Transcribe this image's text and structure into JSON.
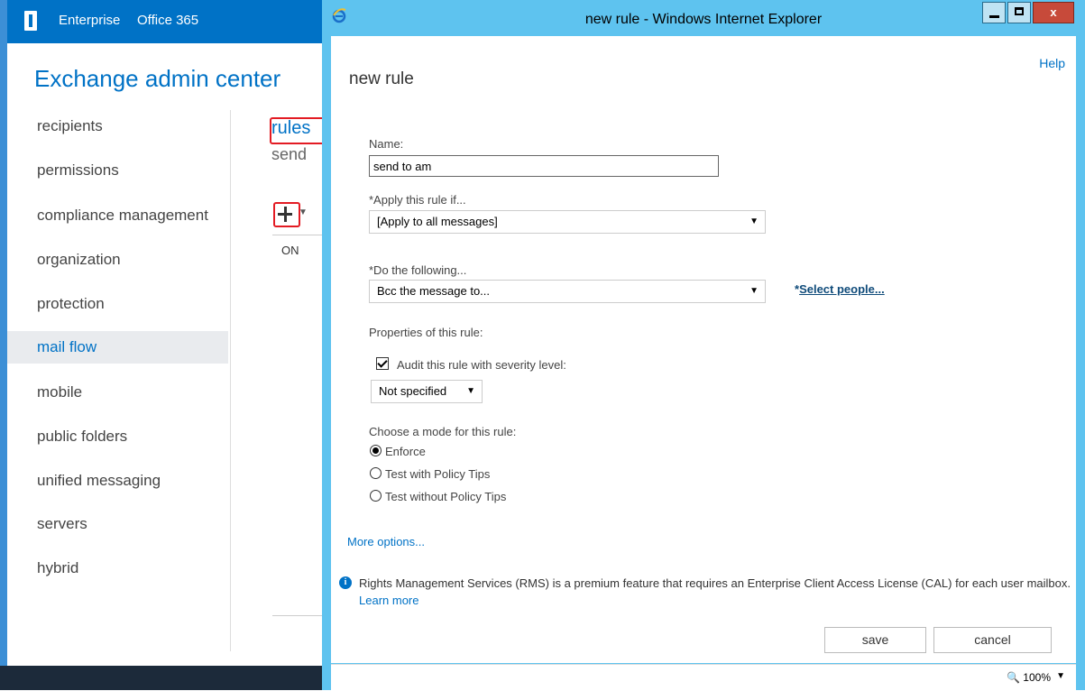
{
  "eac": {
    "topbar": {
      "enterprise": "Enterprise",
      "office365": "Office 365"
    },
    "title": "Exchange admin center",
    "nav": [
      {
        "label": "recipients"
      },
      {
        "label": "permissions"
      },
      {
        "label": "compliance management"
      },
      {
        "label": "organization"
      },
      {
        "label": "protection"
      },
      {
        "label": "mail flow"
      },
      {
        "label": "mobile"
      },
      {
        "label": "public folders"
      },
      {
        "label": "unified messaging"
      },
      {
        "label": "servers"
      },
      {
        "label": "hybrid"
      }
    ],
    "active_nav": "mail flow",
    "rules_link": "rules",
    "send_label": "send",
    "list": {
      "on_cell": "ON"
    },
    "colors": {
      "accent": "#0072c6",
      "highlight": "#e31b23"
    }
  },
  "ie": {
    "title": "new rule - Windows Internet Explorer",
    "close_label": "x",
    "help": "Help",
    "dialog_title": "new rule",
    "name_label": "Name:",
    "name_value": "send to am",
    "apply_label": "*Apply this rule if...",
    "apply_value": "[Apply to all messages]",
    "do_label": "*Do the following...",
    "do_value": "Bcc the message to...",
    "select_people_prefix": "*",
    "select_people": "Select people...",
    "properties_label": "Properties of this rule:",
    "audit_label": "Audit this rule with severity level:",
    "audit_checked": true,
    "severity_value": "Not specified",
    "mode_label": "Choose a mode for this rule:",
    "modes": [
      {
        "label": "Enforce",
        "checked": true
      },
      {
        "label": "Test with Policy Tips",
        "checked": false
      },
      {
        "label": "Test without Policy Tips",
        "checked": false
      }
    ],
    "more_options": "More options...",
    "rms_text": "Rights Management Services (RMS) is a premium feature that requires an Enterprise Client Access License (CAL) for each user mailbox.",
    "learn_more": "Learn more",
    "save": "save",
    "cancel": "cancel",
    "zoom": "100%"
  }
}
